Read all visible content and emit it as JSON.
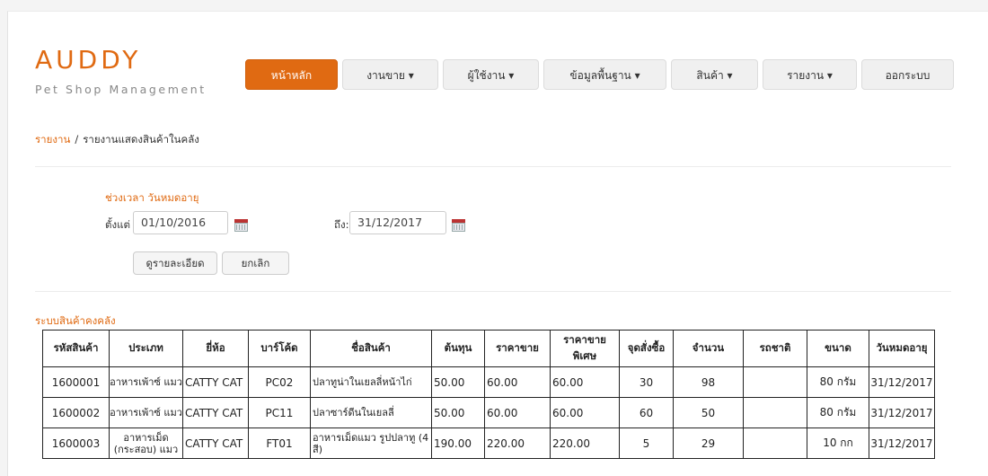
{
  "brand": {
    "name": "AUDDY",
    "subtitle": "Pet Shop Management"
  },
  "nav": {
    "items": [
      {
        "label": "หน้าหลัก",
        "active": true
      },
      {
        "label": "งานขาย ▾"
      },
      {
        "label": "ผู้ใช้งาน ▾"
      },
      {
        "label": "ข้อมูลพื้นฐาน ▾"
      },
      {
        "label": "สินค้า ▾"
      },
      {
        "label": "รายงาน ▾"
      },
      {
        "label": "ออกระบบ"
      }
    ]
  },
  "breadcrumb": {
    "link": "รายงาน",
    "separator": "/",
    "current": "รายงานแสดงสินค้าในคลัง"
  },
  "filter": {
    "title": "ช่วงเวลา วันหมดอายุ",
    "from_label": "ตั้งแต่ :",
    "from_value": "01/10/2016",
    "to_label": "ถึง:",
    "to_value": "31/12/2017",
    "view_button": "ดูรายละเอียด",
    "cancel_button": "ยกเลิก"
  },
  "section_title": "ระบบสินค้าคงคลัง",
  "table": {
    "headers": [
      "รหัสสินค้า",
      "ประเภท",
      "ยี่ห้อ",
      "บาร์โค้ด",
      "ชื่อสินค้า",
      "ต้นทุน",
      "ราคาขาย",
      "ราคาขาย พิเศษ",
      "จุดสั่งซื้อ",
      "จำนวน",
      "รถชาติ",
      "ขนาด",
      "วันหมดอายุ"
    ],
    "rows": [
      [
        "1600001",
        "อาหารเพ้าซ์ แมว",
        "CATTY CAT",
        "PC02",
        "ปลาทูน่าในเยลลี่หน้าไก่",
        "50.00",
        "60.00",
        "60.00",
        "30",
        "98",
        "",
        "80 กรัม",
        "31/12/2017"
      ],
      [
        "1600002",
        "อาหารเพ้าซ์ แมว",
        "CATTY CAT",
        "PC11",
        "ปลาซาร์ดีนในเยลลี่",
        "50.00",
        "60.00",
        "60.00",
        "60",
        "50",
        "",
        "80 กรัม",
        "31/12/2017"
      ],
      [
        "1600003",
        "อาหารเม็ด (กระสอบ) แมว",
        "CATTY CAT",
        "FT01",
        "อาหารเม็ดแมว รูปปลาทู (4 สี)",
        "190.00",
        "220.00",
        "220.00",
        "5",
        "29",
        "",
        "10 กก",
        "31/12/2017"
      ]
    ]
  }
}
